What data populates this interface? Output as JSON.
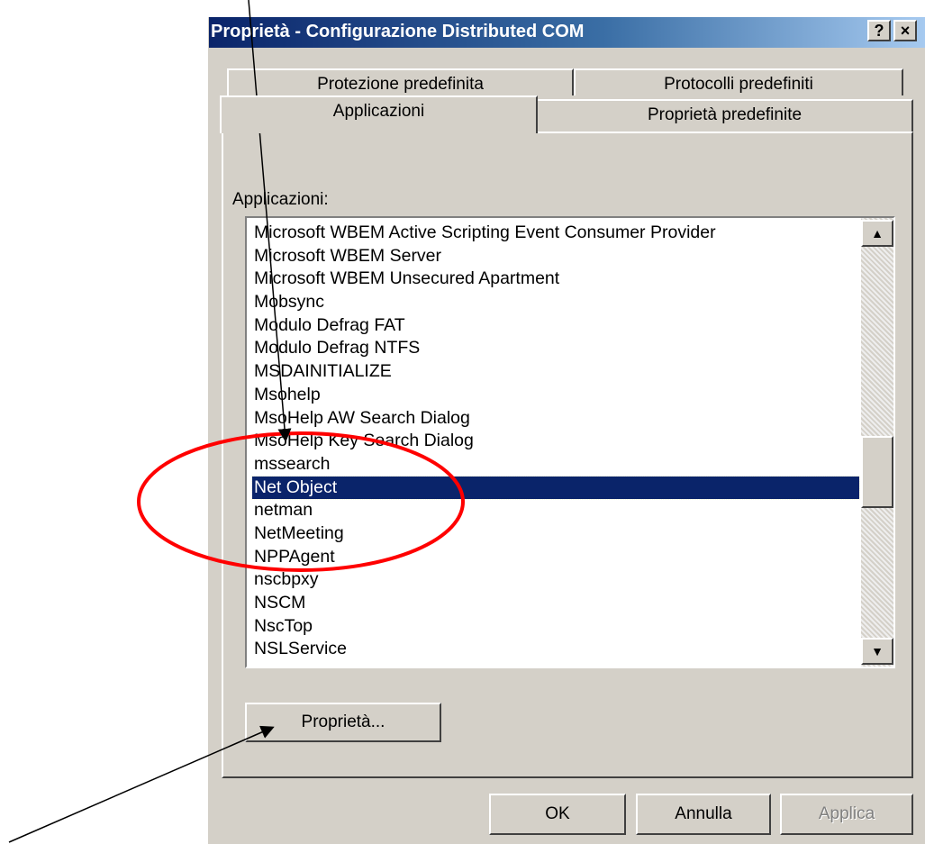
{
  "window": {
    "title": "Proprietà - Configurazione Distributed COM",
    "help_label": "?",
    "close_label": "×"
  },
  "tabs": {
    "back_row": [
      "Protezione predefinita",
      "Protocolli predefiniti"
    ],
    "front_row": [
      "Applicazioni",
      "Proprietà predefinite"
    ],
    "active": "Applicazioni"
  },
  "list": {
    "label": "Applicazioni:",
    "items": [
      "Microsoft WBEM Active Scripting Event Consumer Provider",
      "Microsoft WBEM Server",
      "Microsoft WBEM Unsecured Apartment",
      "Mobsync",
      "Modulo Defrag FAT",
      "Modulo Defrag NTFS",
      "MSDAINITIALIZE",
      "Msohelp",
      "MsoHelp AW Search Dialog",
      "MsoHelp Key Search Dialog",
      "mssearch",
      "Net Object",
      "netman",
      "NetMeeting",
      "NPPAgent",
      "nscbpxy",
      "NSCM",
      "NscTop",
      "NSLService"
    ],
    "selected_item": "Net Object",
    "scroll_up_icon": "scroll-up-arrow-icon",
    "scroll_down_icon": "scroll-down-arrow-icon"
  },
  "buttons": {
    "properties": "Proprietà...",
    "ok": "OK",
    "cancel": "Annulla",
    "apply": "Applica"
  },
  "annotations": {
    "highlight_color": "#ff0000",
    "arrow_color": "#000000"
  },
  "colors": {
    "face": "#d4d0c8",
    "selection": "#0a246a",
    "title_start": "#0a246a",
    "title_end": "#a6caf0"
  }
}
